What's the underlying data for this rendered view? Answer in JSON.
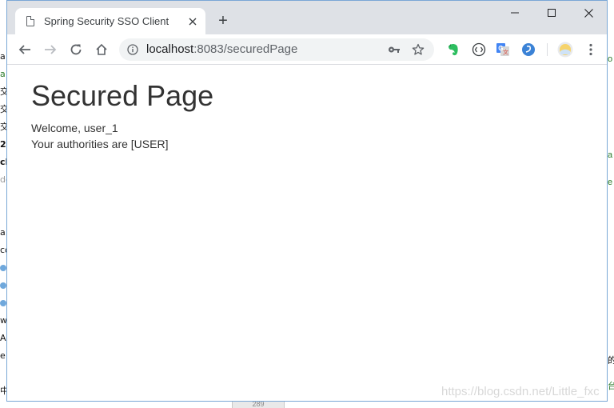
{
  "tab": {
    "title": "Spring Security SSO Client",
    "close": "✕",
    "new_tab": "+"
  },
  "window_controls": {
    "minimize": "minimize",
    "maximize": "maximize",
    "close": "close"
  },
  "address_bar": {
    "host": "localhost",
    "path": ":8083/securedPage"
  },
  "page": {
    "heading": "Secured Page",
    "welcome": "Welcome, user_1",
    "authorities": "Your authorities are [USER]"
  },
  "background": {
    "left_fragments": [
      "a",
      "a",
      "交",
      "交",
      "交",
      "2",
      "ch",
      "de",
      "",
      "",
      "a.f",
      "co",
      "",
      "",
      "",
      "w",
      "Ac",
      "e",
      "",
      "中"
    ],
    "right_fragments": [
      "o",
      "a",
      "e",
      "的",
      "台"
    ],
    "taskbar_number": "289",
    "watermark": "https://blog.csdn.net/Little_fxc"
  },
  "colors": {
    "tabstrip": "#dee1e6",
    "omnibox": "#f1f3f4",
    "heading_text": "#333333",
    "evernote_green": "#2dbe60",
    "translate_blue": "#4285f4",
    "window_border": "#7aa7d6"
  }
}
